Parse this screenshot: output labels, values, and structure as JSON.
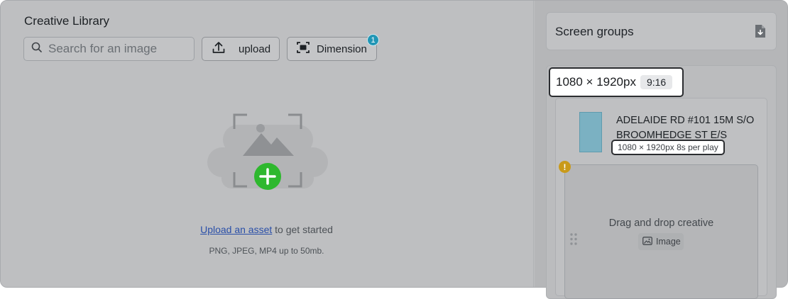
{
  "library": {
    "title": "Creative Library",
    "search_placeholder": "Search for an image",
    "upload_label": "upload",
    "dimension_label": "Dimension",
    "dimension_badge": "1",
    "empty_link": "Upload an asset",
    "empty_suffix": " to get started",
    "formats": "PNG, JPEG, MP4 up to 50mb."
  },
  "sidebar": {
    "groups_title": "Screen groups",
    "resolution": "1080 × 1920px",
    "ratio": "9:16",
    "screen": {
      "name": "ADELAIDE RD #101 15M S/O BROOMHEDGE ST E/S",
      "spec": "1080 × 1920px 8s per play",
      "warning": "!"
    },
    "dropzone": {
      "text": "Drag and drop creative",
      "chip_label": "Image"
    }
  },
  "colors": {
    "overlay": "#bebfc1",
    "badge": "#2196b5",
    "plus": "#2eb82e",
    "warning": "#c99a1a",
    "thumb": "#7bb1c2",
    "link": "#2a4fa8"
  }
}
